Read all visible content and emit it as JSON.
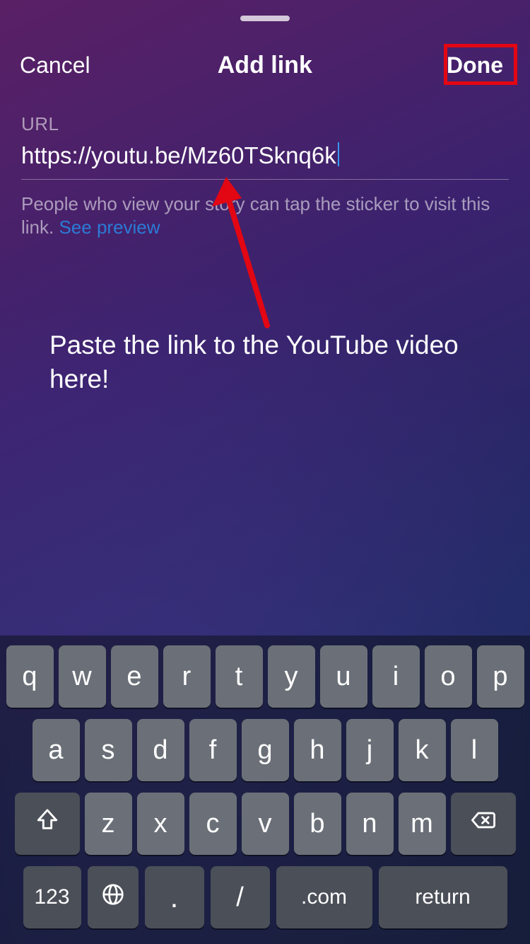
{
  "header": {
    "cancel": "Cancel",
    "title": "Add link",
    "done": "Done"
  },
  "form": {
    "label": "URL",
    "value": "https://youtu.be/Mz60TSknq6k",
    "helper_text": "People who view your story can tap the sticker to visit this link. ",
    "preview_link": "See preview"
  },
  "annotation": {
    "text": "Paste the link to the YouTube video here!",
    "highlight_color": "#e30613"
  },
  "keyboard": {
    "row1": [
      "q",
      "w",
      "e",
      "r",
      "t",
      "y",
      "u",
      "i",
      "o",
      "p"
    ],
    "row2": [
      "a",
      "s",
      "d",
      "f",
      "g",
      "h",
      "j",
      "k",
      "l"
    ],
    "row3": [
      "z",
      "x",
      "c",
      "v",
      "b",
      "n",
      "m"
    ],
    "numbers": "123",
    "dot": ".",
    "slash": "/",
    "com": ".com",
    "return": "return"
  }
}
